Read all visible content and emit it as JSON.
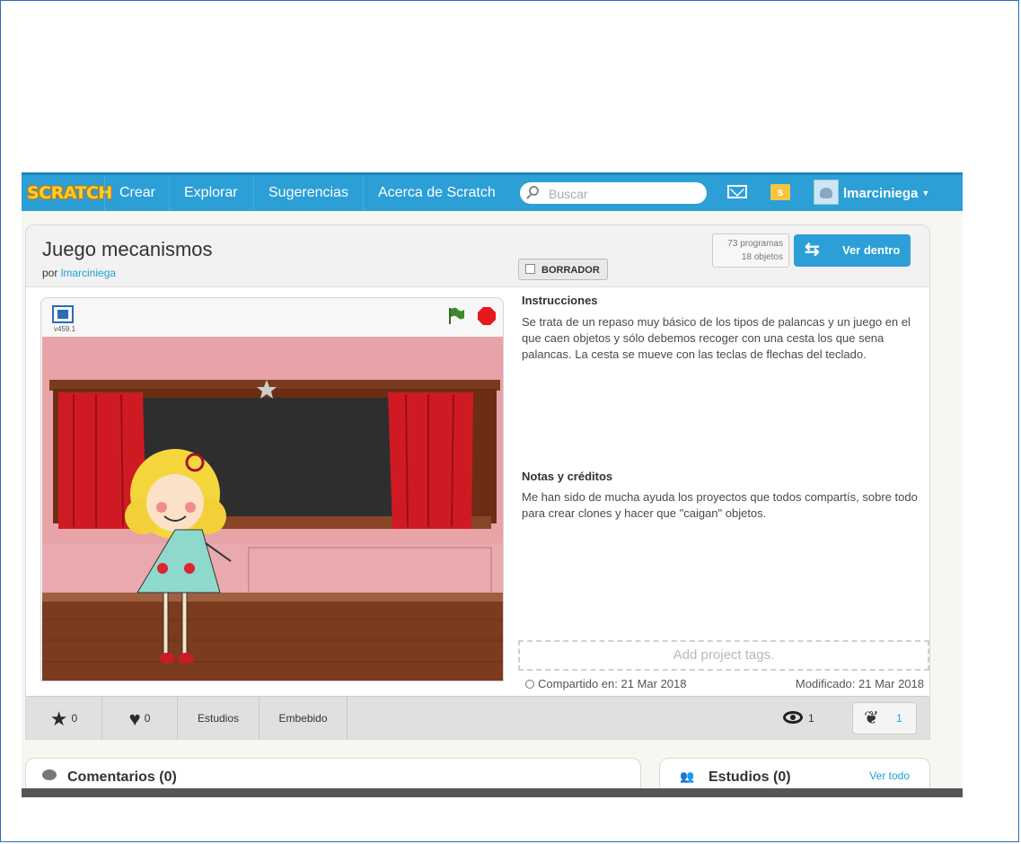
{
  "nav": {
    "logo": "SCRATCH",
    "items": [
      "Crear",
      "Explorar",
      "Sugerencias",
      "Acerca de Scratch"
    ],
    "search_placeholder": "Buscar",
    "folder_badge": "s",
    "username": "lmarciniega"
  },
  "project": {
    "title": "Juego mecanismos",
    "by_prefix": "por",
    "author": "lmarciniega",
    "draft_label": "BORRADOR",
    "scripts_count": "73 programas",
    "sprites_count": "18 objetos",
    "see_inside_label": "Ver dentro",
    "player_version": "v459.1"
  },
  "info": {
    "instructions_title": "Instrucciones",
    "instructions_text": "Se trata de un repaso muy básico de los tipos de palancas y un juego en el que caen objetos y sólo debemos recoger con una cesta los que sena palancas.  La cesta se mueve con las teclas de flechas del teclado.",
    "notes_title": "Notas y créditos",
    "notes_text": "Me han sido de mucha ayuda los proyectos que todos compartís, sobre todo para crear clones y hacer que \"caigan\" objetos.",
    "tags_placeholder": "Add project tags.",
    "shared": "Compartido en: 21 Mar 2018",
    "modified": "Modificado: 21 Mar 2018"
  },
  "stats": {
    "favorites": "0",
    "loves": "0",
    "studios_label": "Estudios",
    "embed_label": "Embebido",
    "views": "1",
    "remixes": "1"
  },
  "panels": {
    "comments_title": "Comentarios (0)",
    "studios_title": "Estudios (0)",
    "see_all": "Ver todo"
  },
  "colors": {
    "nav_blue": "#2b9fd6",
    "link_blue": "#1aa0d8",
    "stop_red": "#e8191b",
    "flag_green": "#3a8a2a"
  }
}
